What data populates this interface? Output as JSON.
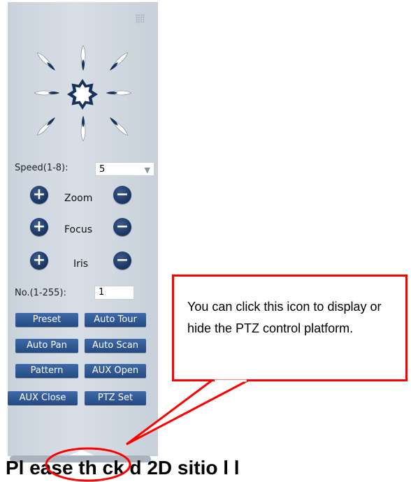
{
  "ptz": {
    "speed_label": "Speed(1-8):",
    "speed_value": "5",
    "zoom_label": "Zoom",
    "focus_label": "Focus",
    "iris_label": "Iris",
    "no_label": "No.(1-255):",
    "no_value": "1",
    "buttons": {
      "preset": "Preset",
      "auto_tour": "Auto Tour",
      "auto_pan": "Auto Pan",
      "auto_scan": "Auto Scan",
      "pattern": "Pattern",
      "aux_open": "AUX Open",
      "aux_close": "AUX Close",
      "ptz_set": "PTZ Set"
    }
  },
  "callout": {
    "text": "You can click this icon to display or hide the PTZ control platform."
  },
  "footer": {
    "text": "Pl ease th ck     d 2D    sitio  l    l"
  },
  "colors": {
    "panel": "#d1d8e0",
    "button": "#2f5690",
    "arrow": "#17325c",
    "callout_border": "#ff0000"
  }
}
